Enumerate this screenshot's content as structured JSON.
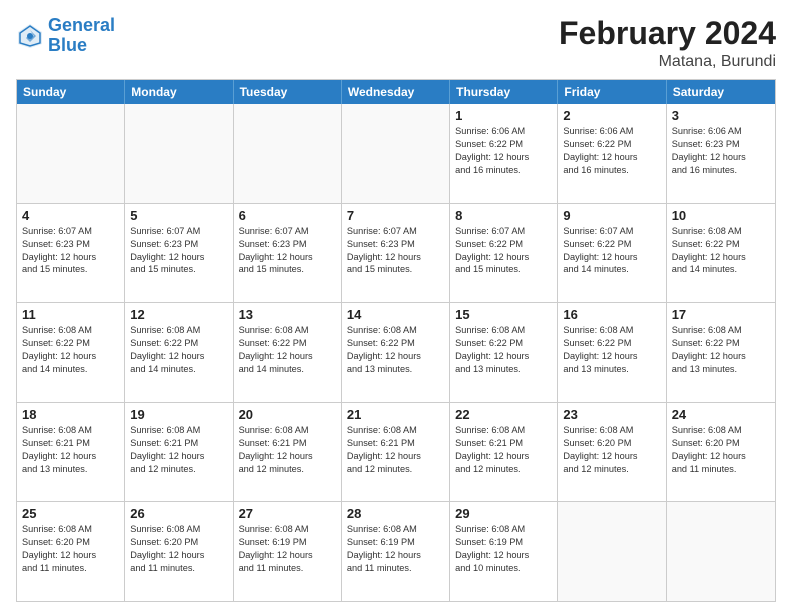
{
  "logo": {
    "line1": "General",
    "line2": "Blue"
  },
  "title": "February 2024",
  "subtitle": "Matana, Burundi",
  "days_of_week": [
    "Sunday",
    "Monday",
    "Tuesday",
    "Wednesday",
    "Thursday",
    "Friday",
    "Saturday"
  ],
  "weeks": [
    [
      {
        "day": "",
        "info": ""
      },
      {
        "day": "",
        "info": ""
      },
      {
        "day": "",
        "info": ""
      },
      {
        "day": "",
        "info": ""
      },
      {
        "day": "1",
        "info": "Sunrise: 6:06 AM\nSunset: 6:22 PM\nDaylight: 12 hours\nand 16 minutes."
      },
      {
        "day": "2",
        "info": "Sunrise: 6:06 AM\nSunset: 6:22 PM\nDaylight: 12 hours\nand 16 minutes."
      },
      {
        "day": "3",
        "info": "Sunrise: 6:06 AM\nSunset: 6:23 PM\nDaylight: 12 hours\nand 16 minutes."
      }
    ],
    [
      {
        "day": "4",
        "info": "Sunrise: 6:07 AM\nSunset: 6:23 PM\nDaylight: 12 hours\nand 15 minutes."
      },
      {
        "day": "5",
        "info": "Sunrise: 6:07 AM\nSunset: 6:23 PM\nDaylight: 12 hours\nand 15 minutes."
      },
      {
        "day": "6",
        "info": "Sunrise: 6:07 AM\nSunset: 6:23 PM\nDaylight: 12 hours\nand 15 minutes."
      },
      {
        "day": "7",
        "info": "Sunrise: 6:07 AM\nSunset: 6:23 PM\nDaylight: 12 hours\nand 15 minutes."
      },
      {
        "day": "8",
        "info": "Sunrise: 6:07 AM\nSunset: 6:22 PM\nDaylight: 12 hours\nand 15 minutes."
      },
      {
        "day": "9",
        "info": "Sunrise: 6:07 AM\nSunset: 6:22 PM\nDaylight: 12 hours\nand 14 minutes."
      },
      {
        "day": "10",
        "info": "Sunrise: 6:08 AM\nSunset: 6:22 PM\nDaylight: 12 hours\nand 14 minutes."
      }
    ],
    [
      {
        "day": "11",
        "info": "Sunrise: 6:08 AM\nSunset: 6:22 PM\nDaylight: 12 hours\nand 14 minutes."
      },
      {
        "day": "12",
        "info": "Sunrise: 6:08 AM\nSunset: 6:22 PM\nDaylight: 12 hours\nand 14 minutes."
      },
      {
        "day": "13",
        "info": "Sunrise: 6:08 AM\nSunset: 6:22 PM\nDaylight: 12 hours\nand 14 minutes."
      },
      {
        "day": "14",
        "info": "Sunrise: 6:08 AM\nSunset: 6:22 PM\nDaylight: 12 hours\nand 13 minutes."
      },
      {
        "day": "15",
        "info": "Sunrise: 6:08 AM\nSunset: 6:22 PM\nDaylight: 12 hours\nand 13 minutes."
      },
      {
        "day": "16",
        "info": "Sunrise: 6:08 AM\nSunset: 6:22 PM\nDaylight: 12 hours\nand 13 minutes."
      },
      {
        "day": "17",
        "info": "Sunrise: 6:08 AM\nSunset: 6:22 PM\nDaylight: 12 hours\nand 13 minutes."
      }
    ],
    [
      {
        "day": "18",
        "info": "Sunrise: 6:08 AM\nSunset: 6:21 PM\nDaylight: 12 hours\nand 13 minutes."
      },
      {
        "day": "19",
        "info": "Sunrise: 6:08 AM\nSunset: 6:21 PM\nDaylight: 12 hours\nand 12 minutes."
      },
      {
        "day": "20",
        "info": "Sunrise: 6:08 AM\nSunset: 6:21 PM\nDaylight: 12 hours\nand 12 minutes."
      },
      {
        "day": "21",
        "info": "Sunrise: 6:08 AM\nSunset: 6:21 PM\nDaylight: 12 hours\nand 12 minutes."
      },
      {
        "day": "22",
        "info": "Sunrise: 6:08 AM\nSunset: 6:21 PM\nDaylight: 12 hours\nand 12 minutes."
      },
      {
        "day": "23",
        "info": "Sunrise: 6:08 AM\nSunset: 6:20 PM\nDaylight: 12 hours\nand 12 minutes."
      },
      {
        "day": "24",
        "info": "Sunrise: 6:08 AM\nSunset: 6:20 PM\nDaylight: 12 hours\nand 11 minutes."
      }
    ],
    [
      {
        "day": "25",
        "info": "Sunrise: 6:08 AM\nSunset: 6:20 PM\nDaylight: 12 hours\nand 11 minutes."
      },
      {
        "day": "26",
        "info": "Sunrise: 6:08 AM\nSunset: 6:20 PM\nDaylight: 12 hours\nand 11 minutes."
      },
      {
        "day": "27",
        "info": "Sunrise: 6:08 AM\nSunset: 6:19 PM\nDaylight: 12 hours\nand 11 minutes."
      },
      {
        "day": "28",
        "info": "Sunrise: 6:08 AM\nSunset: 6:19 PM\nDaylight: 12 hours\nand 11 minutes."
      },
      {
        "day": "29",
        "info": "Sunrise: 6:08 AM\nSunset: 6:19 PM\nDaylight: 12 hours\nand 10 minutes."
      },
      {
        "day": "",
        "info": ""
      },
      {
        "day": "",
        "info": ""
      }
    ]
  ]
}
